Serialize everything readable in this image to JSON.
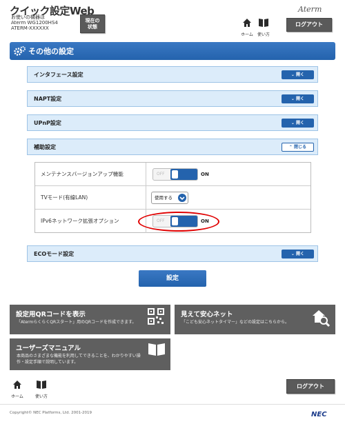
{
  "header": {
    "title": "クイック設定Web",
    "device_label": "お使いの機器は",
    "device_model": "Aterm WG1200HS4",
    "device_id": "ATERM-XXXXXX",
    "status_button": [
      "現在の",
      "状態"
    ],
    "brand": "Aterm",
    "home_label": "ホーム",
    "manual_label": "使い方",
    "logout_label": "ログアウト"
  },
  "page_title": "その他の設定",
  "sections": {
    "interface": {
      "label": "インタフェース設定",
      "button": "開く"
    },
    "napt": {
      "label": "NAPT設定",
      "button": "開く"
    },
    "upnp": {
      "label": "UPnP設定",
      "button": "開く"
    },
    "auxiliary": {
      "label": "補助設定",
      "button": "閉じる"
    },
    "eco": {
      "label": "ECOモード設定",
      "button": "開く"
    }
  },
  "settings": {
    "maintenance": {
      "label": "メンテナンスバージョンアップ機能",
      "off": "OFF",
      "on": "ON"
    },
    "tv_mode": {
      "label": "TVモード(有線LAN)",
      "value": "使用する"
    },
    "ipv6": {
      "label": "IPv6ネットワーク拡張オプション",
      "off": "OFF",
      "on": "ON"
    }
  },
  "apply_button": "設定",
  "tiles": {
    "qr": {
      "title": "設定用QRコードを表示",
      "desc": "「AtermらくらくQRスタート」用のQRコードを作成できます。"
    },
    "safe": {
      "title": "見えて安心ネット",
      "desc": "「こども安心ネットタイマー」などの設定はこちらから。"
    },
    "manual": {
      "title": "ユーザーズマニュアル",
      "desc1": "本商品のさまざまな機能を利用してできることを、わかりやすい操",
      "desc2": "作・設定手順で説明しています。"
    }
  },
  "footer": {
    "home_label": "ホーム",
    "manual_label": "使い方",
    "logout_label": "ログアウト",
    "copyright": "Copyright© NEC Platforms, Ltd. 2001-2019",
    "brand": "NEC"
  },
  "colors": {
    "accent": "#2463ad",
    "section_bg": "#dcecfa",
    "tile_bg": "#5f5f5f",
    "highlight": "#e00000"
  }
}
